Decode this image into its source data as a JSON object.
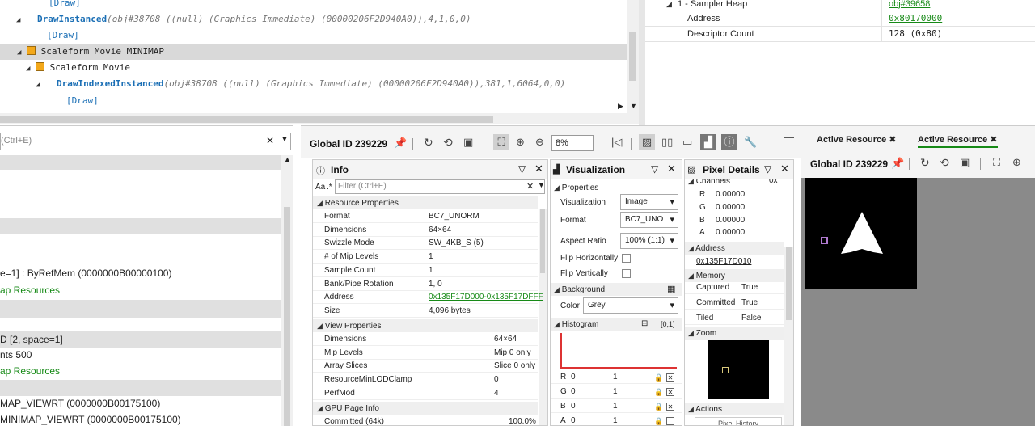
{
  "event_tree": {
    "rows": [
      {
        "text": "[Draw]",
        "args": ""
      },
      {
        "text": "DrawInstanced",
        "args": "(obj#38708 ((null) (Graphics Immediate) (00000206F2D940A0)),4,1,0,0)"
      },
      {
        "text": "[Draw]",
        "args": ""
      },
      {
        "text": "Scaleform Movie MINIMAP",
        "args": ""
      },
      {
        "text": "Scaleform Movie",
        "args": ""
      },
      {
        "text": "DrawIndexedInstanced",
        "args": "(obj#38708 ((null) (Graphics Immediate) (00000206F2D940A0)),381,1,6064,0,0)"
      },
      {
        "text": "[Draw]",
        "args": ""
      }
    ]
  },
  "props_top": {
    "rows": [
      {
        "name": "1 - Sampler Heap",
        "value": "obj#39658"
      },
      {
        "name": "Address",
        "value": "0x80170000"
      },
      {
        "name": "Descriptor Count",
        "value": "128 (0x80)"
      }
    ]
  },
  "left_panel": {
    "filter_placeholder": "(Ctrl+E)",
    "lines": [
      "e=1] : ByRefMem (0000000B00000100)",
      "ap Resources",
      "D [2, space=1]",
      "nts 500",
      "ap Resources",
      "MAP_VIEWRT (0000000B00175100)",
      "MINIMAP_VIEWRT (0000000B00175100)"
    ]
  },
  "resource_toolbar": {
    "title": "Global ID 239229",
    "zoom": "8%"
  },
  "info": {
    "title": "Info",
    "filter_placeholder": "Filter (Ctrl+E)",
    "aa_label": "Aa",
    "regex_label": ".*",
    "sections": {
      "resource": "Resource Properties",
      "view": "View Properties",
      "gpu": "GPU Page Info"
    },
    "resource_props": [
      {
        "k": "Format",
        "v": "BC7_UNORM"
      },
      {
        "k": "Dimensions",
        "v": "64×64"
      },
      {
        "k": "Swizzle Mode",
        "v": "SW_4KB_S (5)"
      },
      {
        "k": "# of Mip Levels",
        "v": "1"
      },
      {
        "k": "Sample Count",
        "v": "1"
      },
      {
        "k": "Bank/Pipe Rotation",
        "v": "1, 0"
      },
      {
        "k": "Address",
        "v": "0x135F17D000-0x135F17DFFF"
      },
      {
        "k": "Size",
        "v": "4,096 bytes"
      }
    ],
    "view_props": [
      {
        "k": "Dimensions",
        "v": "64×64"
      },
      {
        "k": "Mip Levels",
        "v": "Mip 0 only"
      },
      {
        "k": "Array Slices",
        "v": "Slice 0 only"
      },
      {
        "k": "ResourceMinLODClamp",
        "v": "0"
      },
      {
        "k": "PerfMod",
        "v": "4"
      }
    ],
    "gpu_props": [
      {
        "k": "Committed (64k)",
        "v": "100.0%"
      }
    ]
  },
  "visualization": {
    "title": "Visualization",
    "properties_label": "Properties",
    "visualization_label": "Visualization",
    "visualization_value": "Image",
    "format_label": "Format",
    "format_value": "BC7_UNO",
    "aspect_label": "Aspect Ratio",
    "aspect_value": "100% (1:1)",
    "flip_h": "Flip Horizontally",
    "flip_v": "Flip Vertically",
    "background_label": "Background",
    "color_label": "Color",
    "color_value": "Grey",
    "histogram_label": "Histogram",
    "histogram_range": "[0,1]",
    "channels": [
      {
        "c": "R",
        "min": "0",
        "max": "1"
      },
      {
        "c": "G",
        "min": "0",
        "max": "1"
      },
      {
        "c": "B",
        "min": "0",
        "max": "1"
      },
      {
        "c": "A",
        "min": "0",
        "max": "1"
      }
    ]
  },
  "pixel_details": {
    "title": "Pixel Details",
    "channels_label": "Channels",
    "channels_extra": "0x",
    "channels": [
      {
        "c": "R",
        "v": "0.00000"
      },
      {
        "c": "G",
        "v": "0.00000"
      },
      {
        "c": "B",
        "v": "0.00000"
      },
      {
        "c": "A",
        "v": "0.00000"
      }
    ],
    "address_label": "Address",
    "address": "0x135F17D010",
    "memory_label": "Memory",
    "memory": [
      {
        "k": "Captured",
        "v": "True"
      },
      {
        "k": "Committed",
        "v": "True"
      },
      {
        "k": "Tiled",
        "v": "False"
      }
    ],
    "zoom_label": "Zoom",
    "actions_label": "Actions",
    "pixel_history": "Pixel History"
  },
  "active_resource": {
    "tabs": [
      "Active Resource",
      "Active Resource"
    ],
    "title": "Global ID 239229"
  },
  "colors": {
    "accent_green": "#178a17",
    "link_blue": "#1b6fb5",
    "selection_gray": "#d9d9d9"
  }
}
